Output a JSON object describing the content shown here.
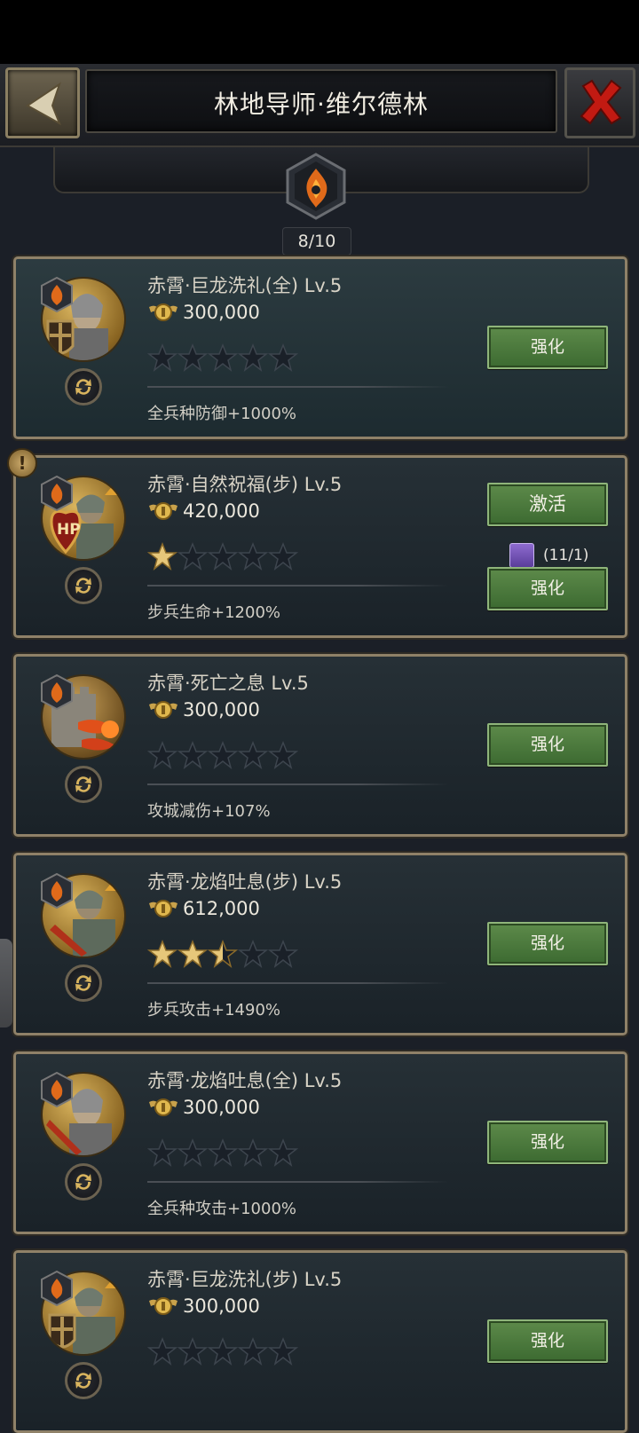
{
  "header": {
    "title": "林地导师·维尔德林"
  },
  "emblem": {
    "count": "8/10"
  },
  "cards": [
    {
      "name": "赤霄·巨龙洗礼(全) Lv.5",
      "cost": "300,000",
      "stars": 0,
      "attr": "全兵种防御+1000%",
      "button": "强化",
      "portrait": "knight"
    },
    {
      "name": "赤霄·自然祝福(步) Lv.5",
      "cost": "420,000",
      "stars": 1,
      "attr": "步兵生命+1200%",
      "button": "强化",
      "activate_button": "激活",
      "requirement": "(11/1)",
      "portrait": "hp",
      "warning": "!"
    },
    {
      "name": "赤霄·死亡之息 Lv.5",
      "cost": "300,000",
      "stars": 0,
      "attr": "攻城减伤+107%",
      "button": "强化",
      "portrait": "siege"
    },
    {
      "name": "赤霄·龙焰吐息(步) Lv.5",
      "cost": "612,000",
      "stars": 2.5,
      "attr": "步兵攻击+1490%",
      "button": "强化",
      "portrait": "infantry"
    },
    {
      "name": "赤霄·龙焰吐息(全) Lv.5",
      "cost": "300,000",
      "stars": 0,
      "attr": "全兵种攻击+1000%",
      "button": "强化",
      "portrait": "sword"
    },
    {
      "name": "赤霄·巨龙洗礼(步) Lv.5",
      "cost": "300,000",
      "stars": 0,
      "attr": "",
      "button": "强化",
      "portrait": "infantry-shield"
    }
  ],
  "icons": {
    "back": "chevron-left-icon",
    "close": "close-x-icon",
    "emblem": "flame-emblem-icon",
    "cost": "winged-coin-icon",
    "swap": "swap-icon",
    "star": "star-icon",
    "requirement": "book-item-icon",
    "warning": "exclamation-icon"
  },
  "colors": {
    "accent_green": "#4e7c3e",
    "frame_gold": "#8f8168",
    "title_white": "#f1ede2",
    "close_red": "#c21a12"
  }
}
